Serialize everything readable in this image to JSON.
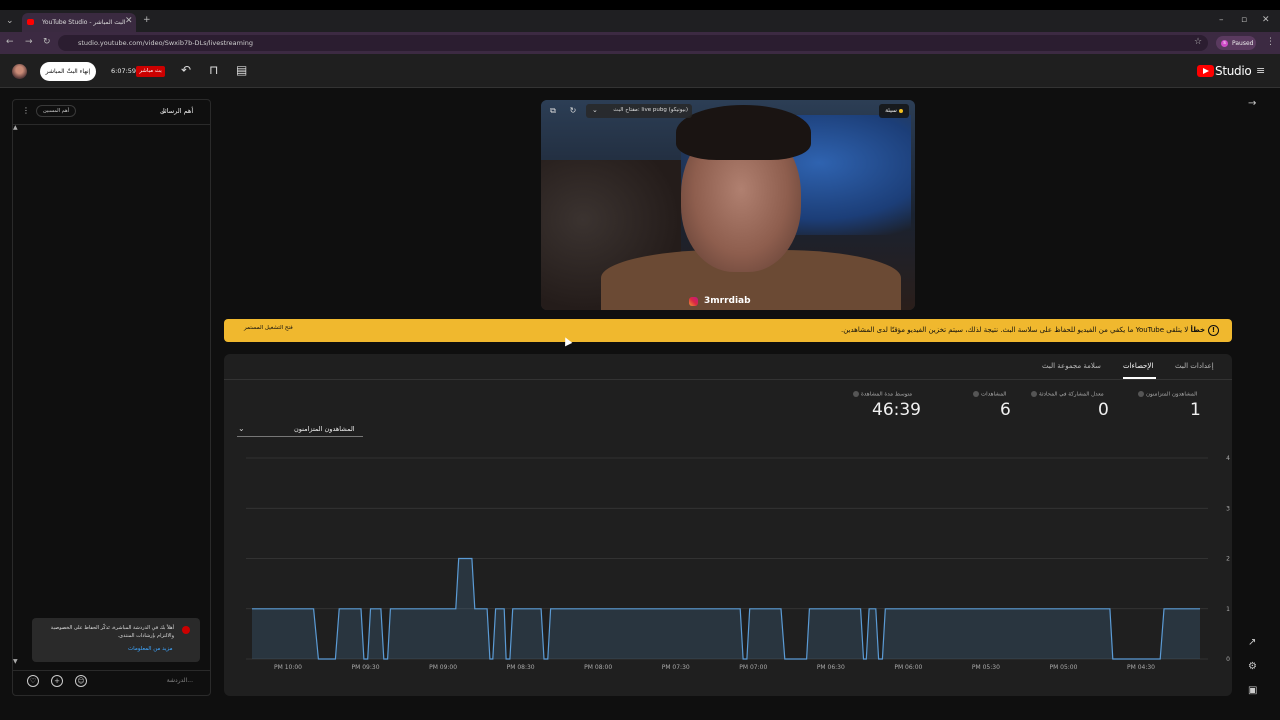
{
  "browser": {
    "tab_title": "YouTube Studio - البث المباشر",
    "url": "studio.youtube.com/video/Swxib7b-DLs/livestreaming",
    "profile_status": "Paused",
    "profile_initial": "s"
  },
  "header": {
    "end_stream_label": "إنهاء البثّ المباشر",
    "timer": "6:07:59",
    "live_badge": "بث مباشر",
    "logo_text": "Studio"
  },
  "chat": {
    "title": "أهم الرسائل",
    "chip_label": "أهم المسبين",
    "notice_text": "أهلاً بك في الدردشة المباشرة، تَذكّر الحفاظ على الخصوصية والالتزام بإرشادات المنتدى.",
    "notice_link": "مزيد من المعلومات",
    "input_placeholder": "الدردشة..."
  },
  "preview": {
    "stream_key_label": "مفتاح البث: live pubg (بيونيكو)",
    "health_label": "سيئة",
    "watermark": "3mrrdiab"
  },
  "banner": {
    "severity": "خطأ",
    "message": "لا يتلقى YouTube ما يكفي من الفيديو للحفاظ على سلاسة البث. نتيجة لذلك، سيتم تخزين الفيديو مؤقتًا لدى المشاهدين.",
    "action_label": "فتح التشغيل المستمر",
    "color": "#f0b82e"
  },
  "tabs": [
    {
      "label": "إعدادات البث",
      "active": false
    },
    {
      "label": "الإحصاءات",
      "active": true
    },
    {
      "label": "سلامة مجموعة البث",
      "active": false
    }
  ],
  "stats": [
    {
      "label": "المشاهدون المتزامنون",
      "value": "1"
    },
    {
      "label": "معدل المشاركة في المحادثة",
      "value": "0"
    },
    {
      "label": "المشاهدات",
      "value": "6"
    },
    {
      "label": "متوسط مدة المشاهدة",
      "value": "46:39"
    }
  ],
  "metric_select": {
    "selected": "المشاهدون المتزامنون"
  },
  "chart_data": {
    "type": "area",
    "series": [
      {
        "name": "المشاهدون المتزامنون",
        "color": "#5b9bd5"
      }
    ],
    "x_ticks": [
      "PM 10:00",
      "PM 09:30",
      "PM 09:00",
      "PM 08:30",
      "PM 08:00",
      "PM 07:30",
      "PM 07:00",
      "PM 06:30",
      "PM 06:00",
      "PM 05:30",
      "PM 05:00",
      "PM 04:30"
    ],
    "y_ticks": [
      "4",
      "3",
      "2",
      "1",
      "0"
    ],
    "ylim": [
      0,
      4
    ],
    "grid": true,
    "segments": [
      [
        0.0,
        1
      ],
      [
        0.065,
        1
      ],
      [
        0.07,
        0
      ],
      [
        0.088,
        0
      ],
      [
        0.092,
        1
      ],
      [
        0.115,
        1
      ],
      [
        0.118,
        0
      ],
      [
        0.122,
        0
      ],
      [
        0.125,
        1
      ],
      [
        0.136,
        1
      ],
      [
        0.139,
        0
      ],
      [
        0.143,
        0
      ],
      [
        0.146,
        1
      ],
      [
        0.215,
        1
      ],
      [
        0.218,
        2
      ],
      [
        0.232,
        2
      ],
      [
        0.235,
        1
      ],
      [
        0.248,
        1
      ],
      [
        0.251,
        0
      ],
      [
        0.254,
        0
      ],
      [
        0.257,
        1
      ],
      [
        0.266,
        1
      ],
      [
        0.268,
        0
      ],
      [
        0.272,
        0
      ],
      [
        0.275,
        1
      ],
      [
        0.305,
        1
      ],
      [
        0.308,
        0
      ],
      [
        0.312,
        0
      ],
      [
        0.315,
        1
      ],
      [
        0.515,
        1
      ],
      [
        0.518,
        0
      ],
      [
        0.522,
        0
      ],
      [
        0.525,
        1
      ],
      [
        0.558,
        1
      ],
      [
        0.562,
        0
      ],
      [
        0.585,
        0
      ],
      [
        0.588,
        1
      ],
      [
        0.642,
        1
      ],
      [
        0.645,
        0
      ],
      [
        0.648,
        0
      ],
      [
        0.651,
        1
      ],
      [
        0.658,
        1
      ],
      [
        0.661,
        0
      ],
      [
        0.665,
        0
      ],
      [
        0.668,
        1
      ],
      [
        0.905,
        1
      ],
      [
        0.908,
        0
      ],
      [
        0.958,
        0
      ],
      [
        0.962,
        1
      ],
      [
        1.0,
        1
      ]
    ]
  },
  "colors": {
    "accent_red": "#ff0000",
    "banner": "#f0b82e",
    "link": "#3ea6ff"
  }
}
